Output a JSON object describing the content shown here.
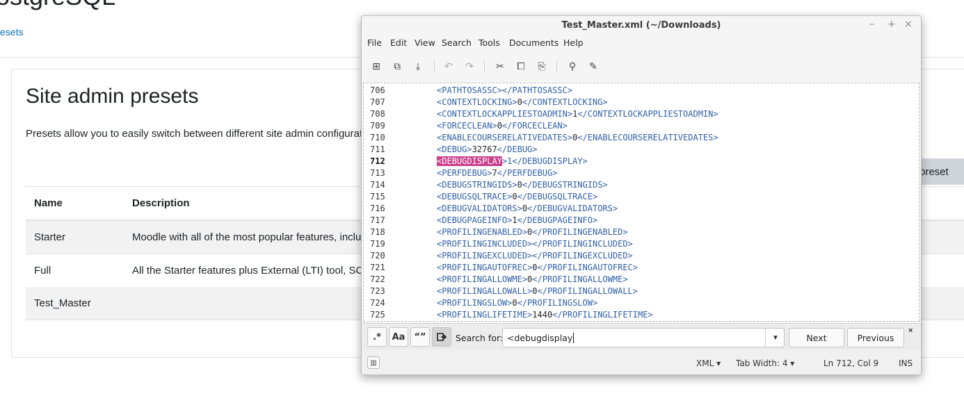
{
  "page": {
    "heading": "ostgreSQL",
    "breadcrumb": "esets",
    "card_title": "Site admin presets",
    "intro": "Presets allow you to easily switch between different site admin configurat",
    "preset_button": "preset",
    "table": {
      "headers": [
        "Name",
        "Description"
      ],
      "rows": [
        {
          "name": "Starter",
          "description": "Moodle with all of the most popular features, inclu"
        },
        {
          "name": "Full",
          "description": "All the Starter features plus External (LTI) tool, SC"
        },
        {
          "name": "Test_Master",
          "description": ""
        }
      ]
    }
  },
  "editor": {
    "title": "Test_Master.xml (~/Downloads)",
    "window_controls": {
      "minimize": "–",
      "maximize": "+",
      "close": "×"
    },
    "menu": [
      "File",
      "Edit",
      "View",
      "Search",
      "Tools",
      "Documents",
      "Help"
    ],
    "toolbar_icons": [
      "new-document-icon",
      "open-document-icon",
      "save-icon",
      "undo-icon",
      "redo-icon",
      "cut-icon",
      "copy-icon",
      "paste-icon",
      "search-icon",
      "replace-icon"
    ],
    "current_line": "712",
    "lines": [
      {
        "n": "706",
        "open": "<PATHTOSASSC>",
        "val": "",
        "close": "</PATHTOSASSC>"
      },
      {
        "n": "707",
        "open": "<CONTEXTLOCKING>",
        "val": "0",
        "close": "</CONTEXTLOCKING>"
      },
      {
        "n": "708",
        "open": "<CONTEXTLOCKAPPLIESTOADMIN>",
        "val": "1",
        "close": "</CONTEXTLOCKAPPLIESTOADMIN>"
      },
      {
        "n": "709",
        "open": "<FORCECLEAN>",
        "val": "0",
        "close": "</FORCECLEAN>"
      },
      {
        "n": "710",
        "open": "<ENABLECOURSERELATIVEDATES>",
        "val": "0",
        "close": "</ENABLECOURSERELATIVEDATES>"
      },
      {
        "n": "711",
        "open": "<DEBUG>",
        "val": "32767",
        "close": "</DEBUG>"
      },
      {
        "n": "712",
        "open": "<DEBUGDISPLAY",
        "val": ">1",
        "close": "</DEBUGDISPLAY>"
      },
      {
        "n": "713",
        "open": "<PERFDEBUG>",
        "val": "7",
        "close": "</PERFDEBUG>"
      },
      {
        "n": "714",
        "open": "<DEBUGSTRINGIDS>",
        "val": "0",
        "close": "</DEBUGSTRINGIDS>"
      },
      {
        "n": "715",
        "open": "<DEBUGSQLTRACE>",
        "val": "0",
        "close": "</DEBUGSQLTRACE>"
      },
      {
        "n": "716",
        "open": "<DEBUGVALIDATORS>",
        "val": "0",
        "close": "</DEBUGVALIDATORS>"
      },
      {
        "n": "717",
        "open": "<DEBUGPAGEINFO>",
        "val": "1",
        "close": "</DEBUGPAGEINFO>"
      },
      {
        "n": "718",
        "open": "<PROFILINGENABLED>",
        "val": "0",
        "close": "</PROFILINGENABLED>"
      },
      {
        "n": "719",
        "open": "<PROFILINGINCLUDED>",
        "val": "",
        "close": "</PROFILINGINCLUDED>"
      },
      {
        "n": "720",
        "open": "<PROFILINGEXCLUDED>",
        "val": "",
        "close": "</PROFILINGEXCLUDED>"
      },
      {
        "n": "721",
        "open": "<PROFILINGAUTOFREC>",
        "val": "0",
        "close": "</PROFILINGAUTOFREC>"
      },
      {
        "n": "722",
        "open": "<PROFILINGALLOWME>",
        "val": "0",
        "close": "</PROFILINGALLOWME>"
      },
      {
        "n": "723",
        "open": "<PROFILINGALLOWALL>",
        "val": "0",
        "close": "</PROFILINGALLOWALL>"
      },
      {
        "n": "724",
        "open": "<PROFILINGSLOW>",
        "val": "0",
        "close": "</PROFILINGSLOW>"
      },
      {
        "n": "725",
        "open": "<PROFILINGLIFETIME>",
        "val": "1440",
        "close": "</PROFILINGLIFETIME>"
      }
    ],
    "search": {
      "regex_label": ".*",
      "case_label": "Aa",
      "whole_word_label": "“”",
      "wrap_icon": "wrap-around-icon",
      "label": "Search for:",
      "value": "<debugdisplay",
      "next": "Next",
      "previous": "Previous",
      "close": "×"
    },
    "status": {
      "language": "XML",
      "tab_width": "Tab Width: 4",
      "position": "Ln 712, Col 9",
      "mode": "INS"
    }
  },
  "colors": {
    "link": "#0f6cbf",
    "tag": "#2e5fa8",
    "highlight": "#c93f8c"
  }
}
